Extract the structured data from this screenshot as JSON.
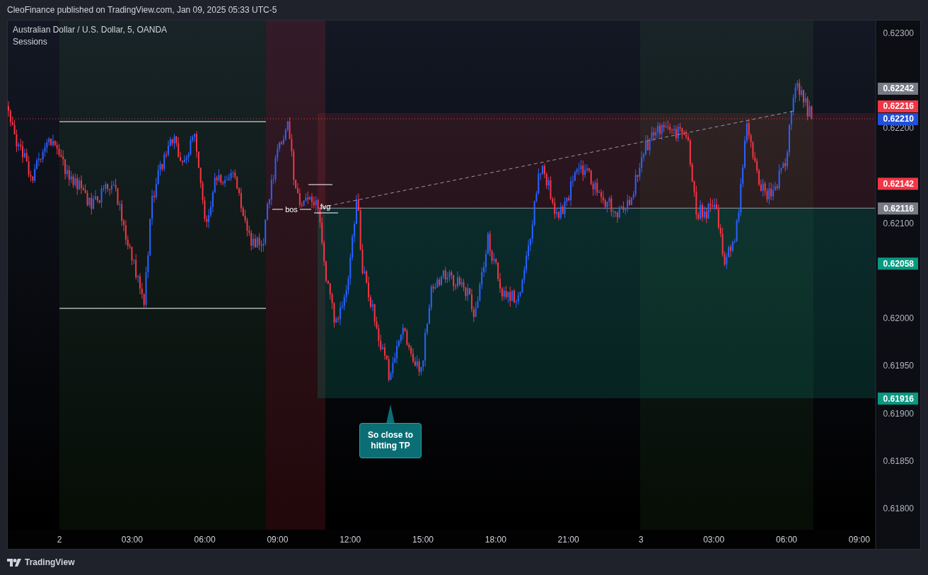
{
  "header": {
    "text": "CleoFinance published on TradingView.com, Jan 09, 2025 05:33 UTC-5"
  },
  "chart": {
    "title": "Australian Dollar / U.S. Dollar, 5, OANDA",
    "indicator": "Sessions",
    "annotations": [
      {
        "kind": "label",
        "text": "bos"
      },
      {
        "kind": "label",
        "text": "fvg"
      },
      {
        "kind": "callout",
        "text": "So close to hitting TP"
      }
    ]
  },
  "price_axis": {
    "ticks": [
      "0.62300",
      "0.62200",
      "0.62100",
      "0.62000",
      "0.61950",
      "0.61900",
      "0.61850",
      "0.61800"
    ],
    "labels": [
      {
        "text": "0.62242",
        "color": "#787b86"
      },
      {
        "text": "0.62216",
        "color": "#f23645"
      },
      {
        "text": "0.62210",
        "color": "#2150d8"
      },
      {
        "text": "0.62142",
        "color": "#f23645"
      },
      {
        "text": "0.62116",
        "color": "#787b86"
      },
      {
        "text": "0.62058",
        "color": "#089981"
      },
      {
        "text": "0.61916",
        "color": "#089981"
      }
    ]
  },
  "time_axis": {
    "labels": [
      "2",
      "03:00",
      "06:00",
      "09:00",
      "12:00",
      "15:00",
      "18:00",
      "21:00",
      "3",
      "03:00",
      "06:00",
      "09:00"
    ]
  },
  "footer": {
    "brand": "TradingView"
  }
}
